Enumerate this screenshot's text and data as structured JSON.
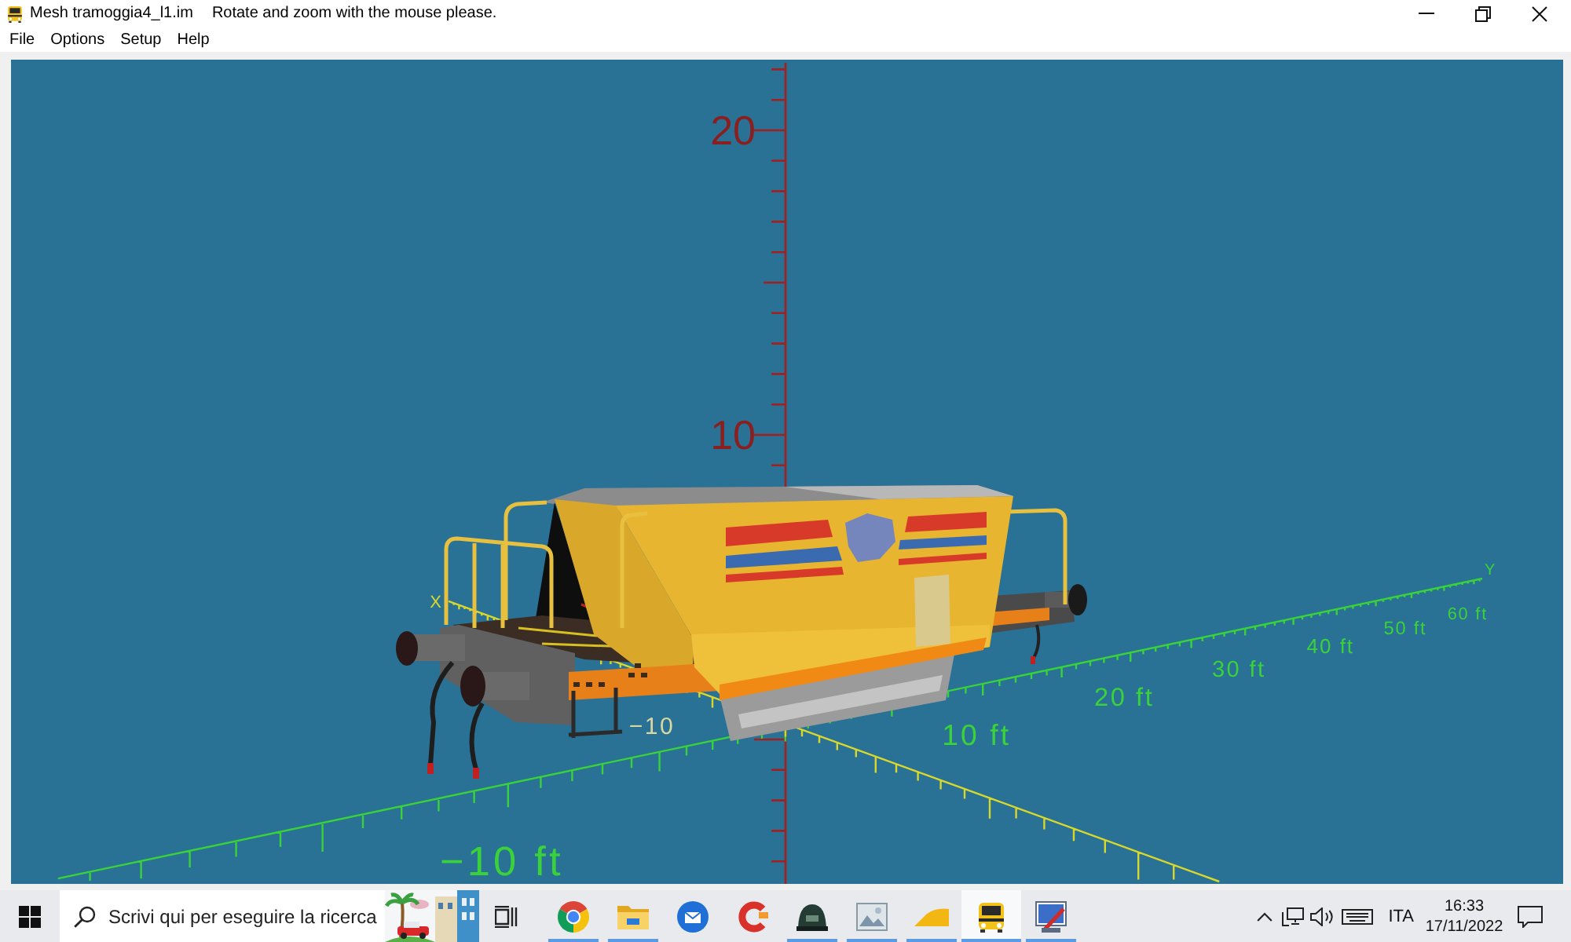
{
  "window": {
    "title": "Mesh tramoggia4_l1.im",
    "hint": "Rotate and zoom with the mouse please."
  },
  "menu": [
    "File",
    "Options",
    "Setup",
    "Help"
  ],
  "viewport": {
    "z_axis": {
      "labels": [
        "20",
        "10"
      ]
    },
    "x_axis": {
      "name": "X",
      "labels": [
        "−10"
      ]
    },
    "y_axis": {
      "name": "Y",
      "labels": [
        "−10 ft",
        "10 ft",
        "20 ft",
        "30 ft",
        "40 ft",
        "50 ft",
        "60 ft"
      ]
    }
  },
  "taskbar": {
    "search": {
      "placeholder": "Scrivi qui per eseguire la ricerca"
    },
    "apps": [
      {
        "kind": "browser",
        "running": true,
        "selected": false
      },
      {
        "kind": "files",
        "running": true,
        "selected": false
      },
      {
        "kind": "mail",
        "running": false,
        "selected": false
      },
      {
        "kind": "cleaner",
        "running": false,
        "selected": false
      },
      {
        "kind": "dome",
        "running": true,
        "selected": false
      },
      {
        "kind": "viewer",
        "running": true,
        "selected": false
      },
      {
        "kind": "wedge",
        "running": true,
        "selected": false
      },
      {
        "kind": "train",
        "running": true,
        "selected": true
      },
      {
        "kind": "editor",
        "running": true,
        "selected": false
      }
    ],
    "tray": {
      "language": "ITA",
      "time": "16:33",
      "date": "17/11/2022"
    }
  }
}
